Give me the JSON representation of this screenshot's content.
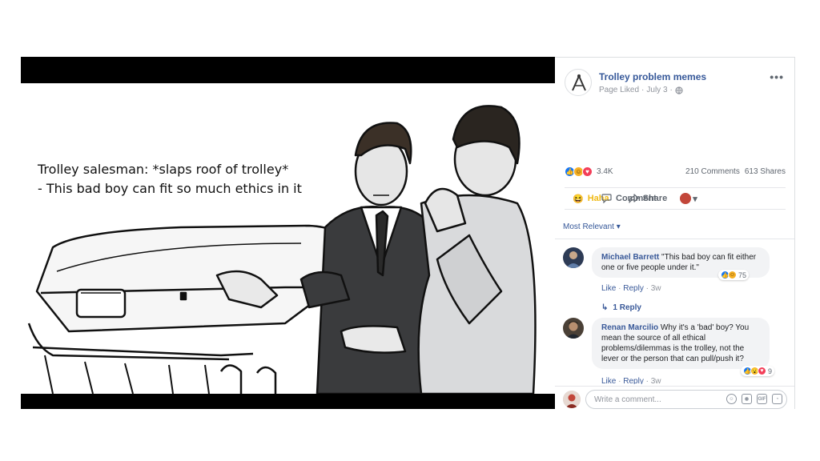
{
  "meme": {
    "caption_line1": "Trolley salesman: *slaps roof of trolley*",
    "caption_line2": "- This bad boy can fit so much ethics in it"
  },
  "post": {
    "page_name": "Trolley problem memes",
    "liked_label": "Page Liked",
    "date": "July 3",
    "separator": "·",
    "more_label": "•••",
    "reaction_count": "3.4K",
    "comments_count": "210 Comments",
    "shares_count": "613 Shares",
    "reaction_icons": [
      "like",
      "haha",
      "love"
    ]
  },
  "actions": {
    "haha_label": "Haha",
    "comment_label": "Comment",
    "share_label": "Share"
  },
  "comments_header": {
    "sort_label": "Most Relevant ▾"
  },
  "comments": [
    {
      "author": "Michael Barrett",
      "text": "\"This bad boy can fit either one or five people under it.\"",
      "like_label": "Like",
      "reply_label": "Reply",
      "age": "3w",
      "reaction_count": "75",
      "reaction_icons": [
        "like",
        "haha"
      ],
      "replies_label": "1 Reply"
    },
    {
      "author": "Renan Marcilio",
      "text": "Why it's a 'bad' boy? You mean the source of all ethical problems/dilemmas is the trolley, not the lever or the person that can pull/push it?",
      "like_label": "Like",
      "reply_label": "Reply",
      "age": "3w",
      "reaction_count": "9",
      "reaction_icons": [
        "like",
        "wow",
        "love"
      ]
    }
  ],
  "composer": {
    "placeholder": "Write a comment..."
  },
  "colors": {
    "link": "#365899",
    "haha": "#f0ba15",
    "like": "#1877f2",
    "love": "#f33e58"
  },
  "icons": [
    "page-logo-icon",
    "globe-icon",
    "haha-icon",
    "comment-icon",
    "share-icon",
    "caret-down-icon",
    "reply-arrow-icon",
    "emoji-icon",
    "camera-icon",
    "gif-icon",
    "sticker-icon"
  ]
}
